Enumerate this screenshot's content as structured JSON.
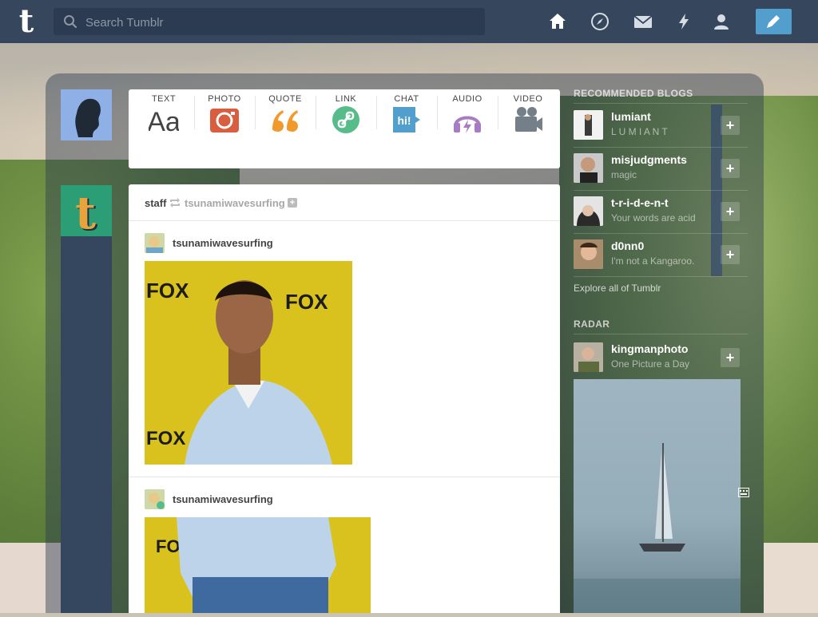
{
  "nav": {
    "search_placeholder": "Search Tumblr",
    "icons": [
      "home-icon",
      "explore-icon",
      "inbox-icon",
      "activity-icon",
      "account-icon",
      "compose-icon"
    ]
  },
  "post_types": [
    {
      "label": "TEXT",
      "icon": "text-icon",
      "color": "#444444"
    },
    {
      "label": "PHOTO",
      "icon": "camera-icon",
      "color": "#d95e40"
    },
    {
      "label": "QUOTE",
      "icon": "quote-icon",
      "color": "#f2992e"
    },
    {
      "label": "LINK",
      "icon": "link-icon",
      "color": "#56bc8a"
    },
    {
      "label": "CHAT",
      "icon": "chat-icon",
      "color": "#529ecc"
    },
    {
      "label": "AUDIO",
      "icon": "headphones-icon",
      "color": "#a77dc2"
    },
    {
      "label": "VIDEO",
      "icon": "video-camera-icon",
      "color": "#748089"
    }
  ],
  "post": {
    "reblogger": "staff",
    "source": "tsunamiwavesurfing",
    "entries": [
      {
        "name": "tsunamiwavesurfing"
      },
      {
        "name": "tsunamiwavesurfing"
      }
    ]
  },
  "sidebar": {
    "recommended_heading": "RECOMMENDED BLOGS",
    "recommended": [
      {
        "name": "lumiant",
        "sub": "L U M I A N T"
      },
      {
        "name": "misjudgments",
        "sub": "magic"
      },
      {
        "name": "t-r-i-d-e-n-t",
        "sub": "Your words are acid"
      },
      {
        "name": "d0nn0",
        "sub": "I'm not a Kangaroo."
      }
    ],
    "explore_link": "Explore all of Tumblr",
    "radar_heading": "RADAR",
    "radar": {
      "name": "kingmanphoto",
      "sub": "One Picture a Day"
    }
  },
  "colors": {
    "nav": "#36465d",
    "accent": "#529ecc",
    "card": "#ffffff"
  }
}
